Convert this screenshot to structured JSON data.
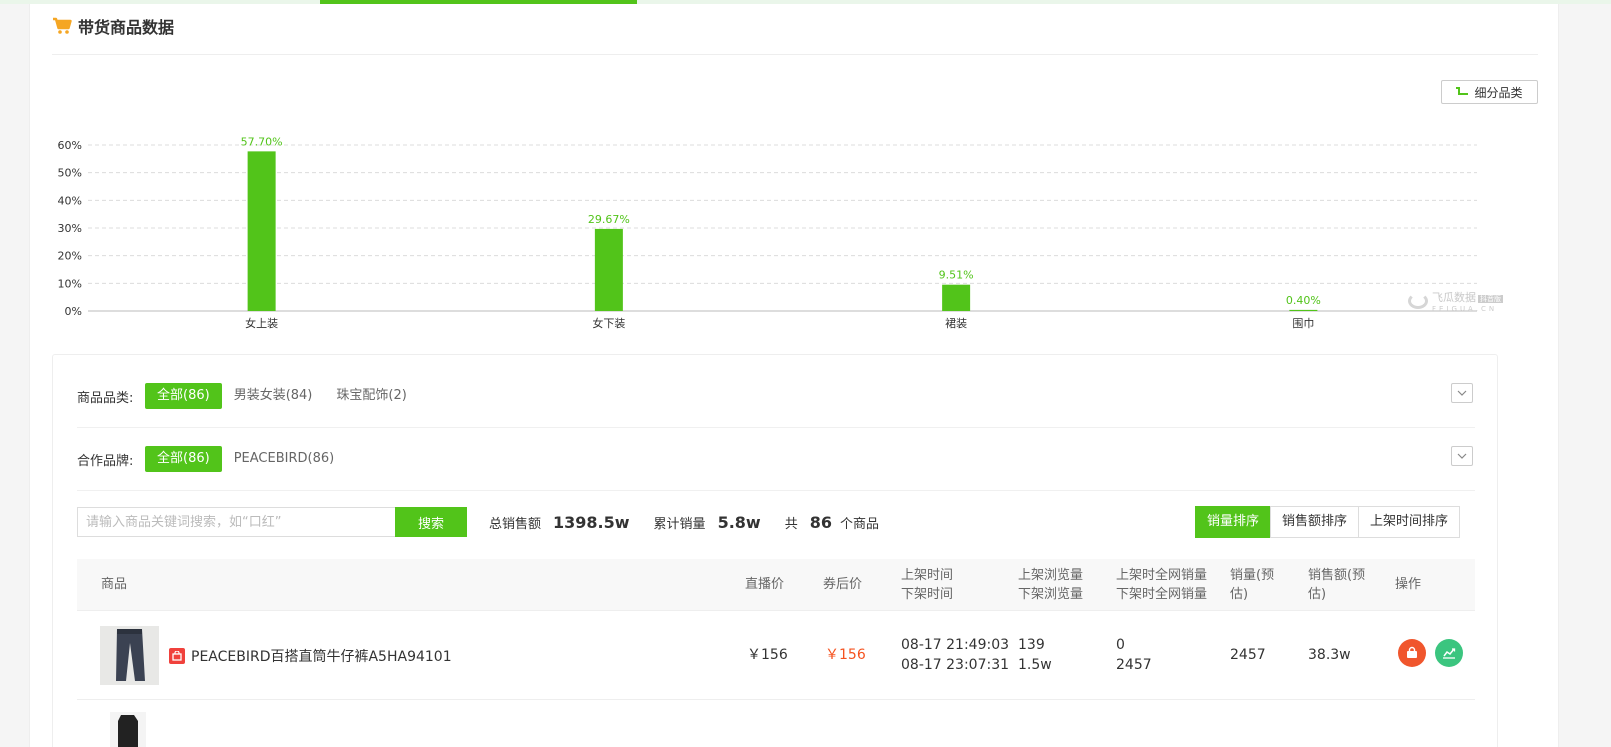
{
  "section": {
    "title": "带货商品数据",
    "subcategory_button": "细分品类"
  },
  "chart_data": {
    "type": "bar",
    "categories": [
      "女上装",
      "女下装",
      "裙装",
      "围巾"
    ],
    "values": [
      57.7,
      29.67,
      9.51,
      0.4
    ],
    "value_labels": [
      "57.70%",
      "29.67%",
      "9.51%",
      "0.40%"
    ],
    "y_ticks": [
      "0%",
      "10%",
      "20%",
      "30%",
      "40%",
      "50%",
      "60%"
    ],
    "ylim": [
      0,
      60
    ],
    "grid": true,
    "bar_color": "#52c41a"
  },
  "watermark": {
    "name": "飞瓜数据",
    "tag": "抖音版",
    "url": "FEIGUA.CN"
  },
  "filters": {
    "category": {
      "label": "商品品类:",
      "options": [
        "全部(86)",
        "男装女装(84)",
        "珠宝配饰(2)"
      ]
    },
    "brand": {
      "label": "合作品牌:",
      "options": [
        "全部(86)",
        "PEACEBIRD(86)"
      ]
    }
  },
  "search": {
    "placeholder": "请输入商品关键词搜索，如“口红”",
    "button": "搜索"
  },
  "stats": {
    "total_sales_label": "总销售额",
    "total_sales_value": "1398.5w",
    "total_volume_label": "累计销量",
    "total_volume_value": "5.8w",
    "count_prefix": "共",
    "count_value": "86",
    "count_suffix": "个商品"
  },
  "sort": [
    "销量排序",
    "销售额排序",
    "上架时间排序"
  ],
  "table": {
    "headers": {
      "product": "商品",
      "live_price": "直播价",
      "coupon_price": "券后价",
      "time_on": "上架时间",
      "time_off": "下架时间",
      "views_on": "上架浏览量",
      "views_off": "下架浏览量",
      "net_on": "上架时全网销量",
      "net_off": "下架时全网销量",
      "sales": "销量(预估)",
      "revenue": "销售额(预估)",
      "action": "操作"
    },
    "rows": [
      {
        "name": "PEACEBIRD百搭直筒牛仔裤A5HA94101",
        "live_price": "￥156",
        "coupon_price": "￥156",
        "time_on": "08-17 21:49:03",
        "time_off": "08-17 23:07:31",
        "views_on": "139",
        "views_off": "1.5w",
        "net_on": "0",
        "net_off": "2457",
        "sales": "2457",
        "revenue": "38.3w"
      }
    ]
  },
  "colors": {
    "accent": "#52c41a",
    "price_red": "#f5521f",
    "action_orange": "#f0562d",
    "action_green": "#3bc57f"
  }
}
